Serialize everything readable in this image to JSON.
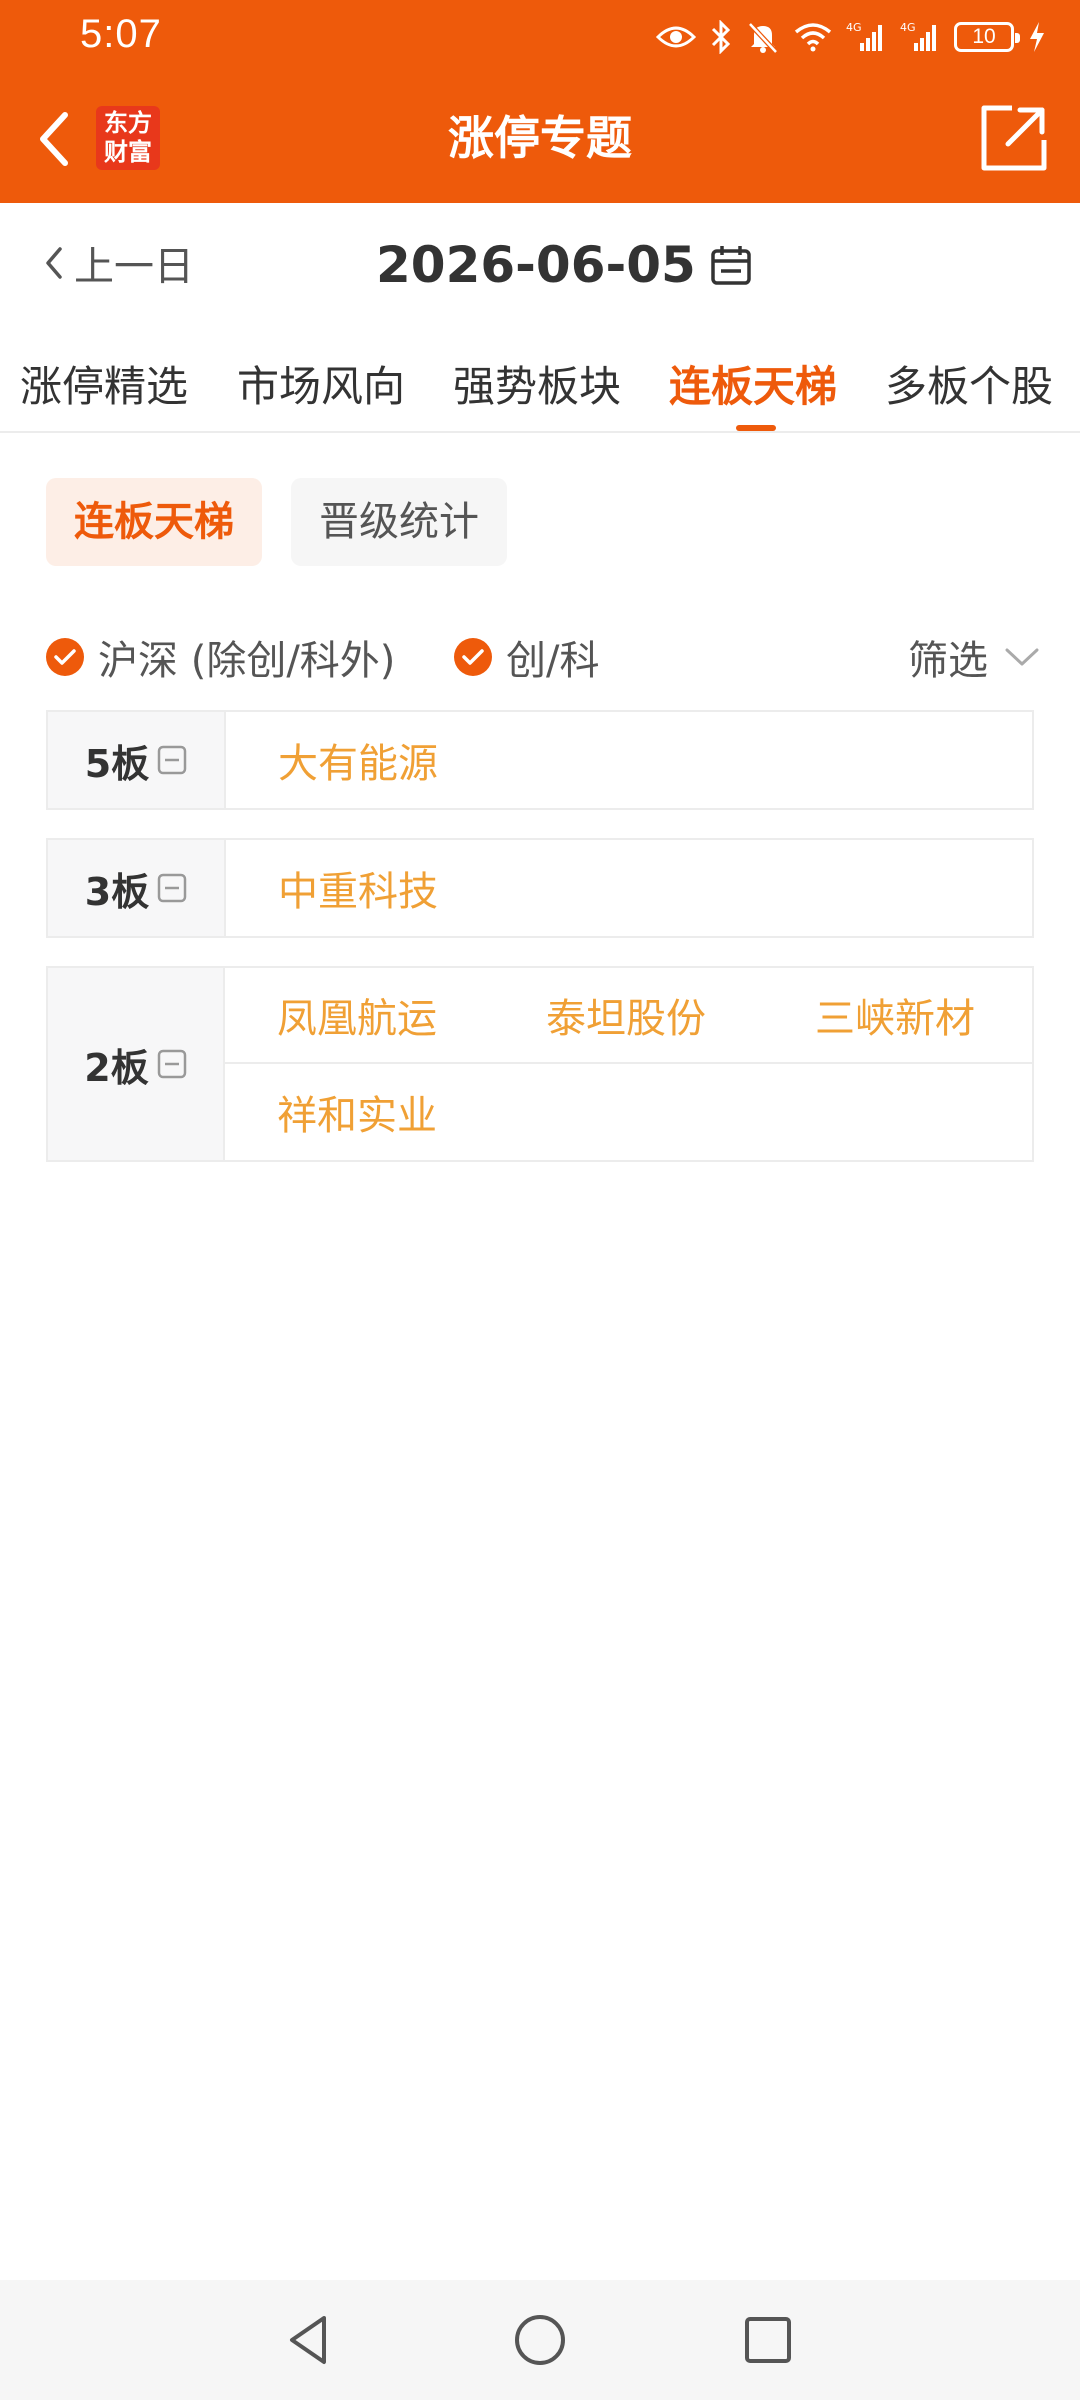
{
  "status_bar": {
    "time": "5:07",
    "battery": "10",
    "icons": [
      "eye-icon",
      "bluetooth-icon",
      "mute-icon",
      "wifi-icon",
      "signal-4g-icon",
      "signal-4g-icon",
      "battery-icon",
      "charging-icon"
    ]
  },
  "header": {
    "title": "涨停专题",
    "logo_line1": "东方",
    "logo_line2": "财富",
    "accent": "#ee5a0b"
  },
  "date_nav": {
    "prev_label": "上一日",
    "date": "2026-06-05"
  },
  "tabs": [
    {
      "label": "涨停精选",
      "active": false
    },
    {
      "label": "市场风向",
      "active": false
    },
    {
      "label": "强势板块",
      "active": false
    },
    {
      "label": "连板天梯",
      "active": true
    },
    {
      "label": "多板个股",
      "active": false
    }
  ],
  "sub_tabs": [
    {
      "label": "连板天梯",
      "active": true
    },
    {
      "label": "晋级统计",
      "active": false
    }
  ],
  "filters": {
    "options": [
      {
        "label": "沪深 (除创/科外)",
        "checked": true
      },
      {
        "label": "创/科",
        "checked": true
      }
    ],
    "filter_label": "筛选"
  },
  "boards": [
    {
      "label": "5板",
      "stocks": [
        "大有能源"
      ]
    },
    {
      "label": "3板",
      "stocks": [
        "中重科技"
      ]
    },
    {
      "label": "2板",
      "stocks": [
        "凤凰航运",
        "泰坦股份",
        "三峡新材",
        "祥和实业"
      ]
    }
  ]
}
